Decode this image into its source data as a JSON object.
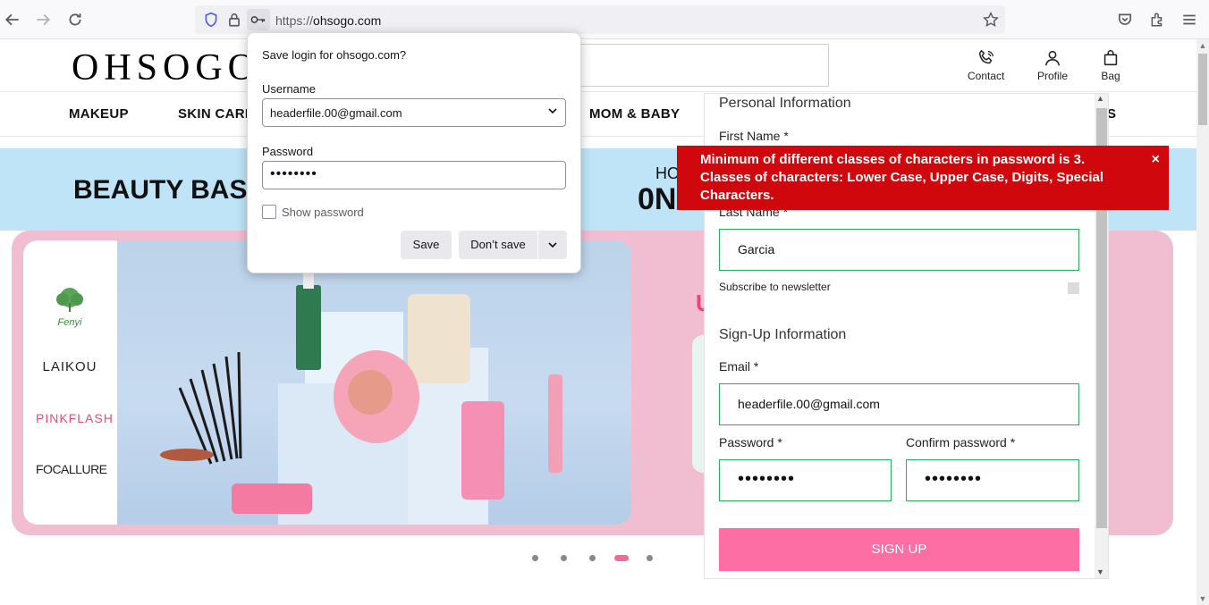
{
  "browser": {
    "url_prefix": "https://",
    "url_domain": "ohsogo.com"
  },
  "site": {
    "logo": "OHSOGO",
    "header_links": {
      "contact": "Contact",
      "profile": "Profile",
      "bag": "Bag"
    },
    "nav": [
      "MAKEUP",
      "SKIN CARE",
      "MOM & BABY",
      "S"
    ],
    "promo": {
      "title": "BEAUTY BASI",
      "side_top": "HO",
      "side_big": "0N"
    },
    "hero": {
      "brands": [
        "Fenyi",
        "LAIKOU",
        "PINKFLASH",
        "FOCALLURE"
      ],
      "partial_letter": "U"
    },
    "carousel": {
      "count": 5,
      "active_index": 3
    }
  },
  "registration": {
    "personal_heading": "Personal Information",
    "first_name_label": "First Name *",
    "last_name_label": "Last Name *",
    "last_name_value": "Garcia",
    "newsletter_label": "Subscribe to newsletter",
    "signup_heading": "Sign-Up Information",
    "email_label": "Email *",
    "email_value": "headerfile.00@gmail.com",
    "password_label": "Password *",
    "password_value": "••••••••",
    "confirm_label": "Confirm password *",
    "confirm_value": "••••••••",
    "signup_button": "SIGN UP"
  },
  "error": {
    "message": "Minimum of different classes of characters in password is 3. Classes of characters: Lower Case, Upper Case, Digits, Special Characters.",
    "close": "×",
    "color": "#d0080d"
  },
  "save_login_popup": {
    "title": "Save login for ohsogo.com?",
    "username_label": "Username",
    "username_value": "headerfile.00@gmail.com",
    "password_label": "Password",
    "password_value": "••••••••",
    "show_password_label": "Show password",
    "save_button": "Save",
    "dont_save_button": "Don’t save"
  },
  "colors": {
    "accent_pink": "#fd6ea4",
    "promo_blue": "#bfe4f7",
    "hero_pink": "#f1bdd0",
    "input_green": "#2eaa60"
  }
}
